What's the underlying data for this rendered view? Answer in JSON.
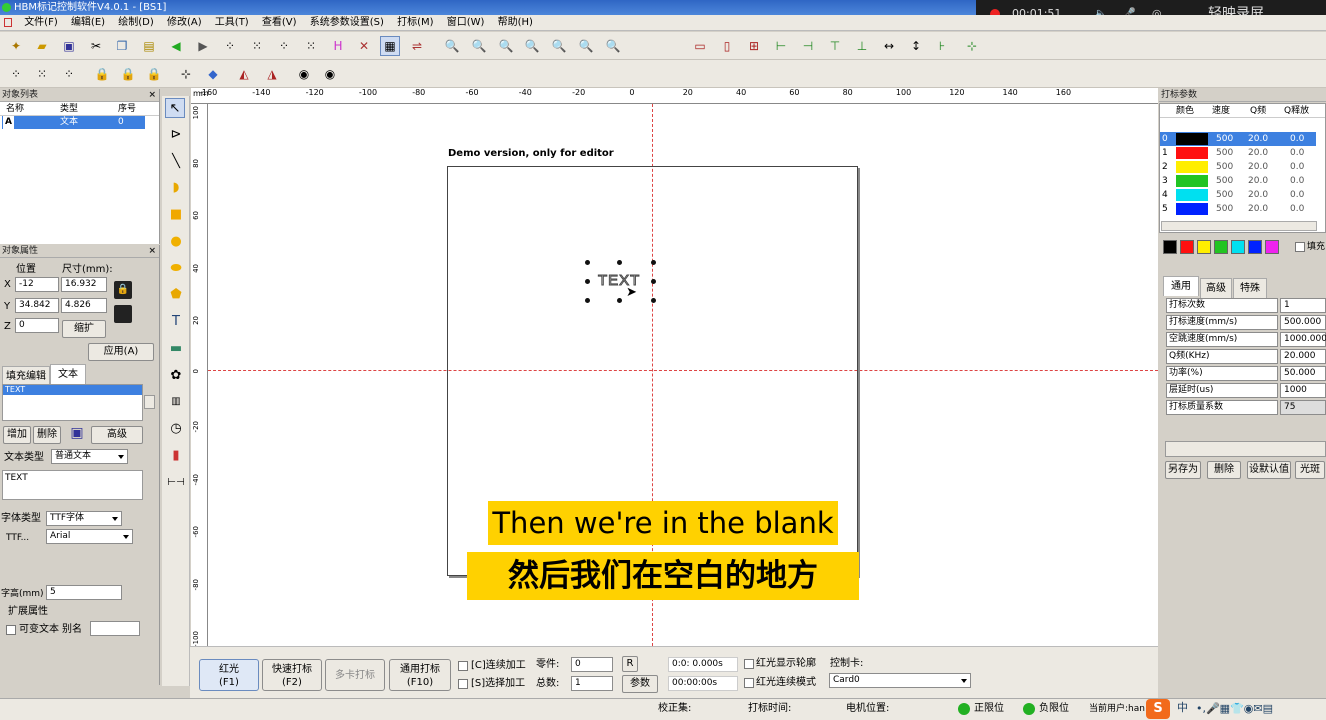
{
  "window": {
    "title": "HBM标记控制软件V4.0.1 - [BS1]"
  },
  "menu": [
    "文件(F)",
    "编辑(E)",
    "绘制(D)",
    "修改(A)",
    "工具(T)",
    "查看(V)",
    "系统参数设置(S)",
    "打标(M)",
    "窗口(W)",
    "帮助(H)"
  ],
  "recorder": {
    "time": "00:01:51",
    "brand": "轻映录屏"
  },
  "object_list": {
    "title": "对象列表",
    "col_name": "名称",
    "col_type": "类型",
    "col_index": "序号",
    "row": {
      "icon": "A",
      "type": "文本",
      "index": "0"
    }
  },
  "object_props": {
    "title": "对象属性",
    "pos_label": "位置",
    "size_label": "尺寸(mm):",
    "x_label": "X",
    "x": "-12",
    "w": "16.932",
    "y_label": "Y",
    "y": "34.842",
    "h": "4.826",
    "z_label": "Z",
    "z": "0",
    "scale_btn": "缩扩",
    "apply_btn": "应用(A)"
  },
  "text_panel": {
    "tab_fill": "填充编辑",
    "tab_text": "文本",
    "list_item": "TEXT",
    "add_btn": "增加",
    "delete_btn": "删除",
    "advanced_btn": "高级",
    "text_type_label": "文本类型",
    "text_type": "普通文本",
    "text_value": "TEXT",
    "font_type_label": "字体类型",
    "font_type": "TTF字体",
    "ttf_label": "TTF...",
    "font_name": "Arial",
    "height_label": "字高(mm)",
    "height": "5",
    "ext_label": "扩展属性",
    "variable_label": "可变文本",
    "alias_label": "别名"
  },
  "canvas": {
    "demo_text": "Demo version, only for editor",
    "object_text": "TEXT",
    "ruler_unit": "mm",
    "ruler_top": [
      "-160",
      "-140",
      "-120",
      "-100",
      "-80",
      "-60",
      "-40",
      "-20",
      "0",
      "20",
      "40",
      "60",
      "80",
      "100",
      "120",
      "140",
      "160"
    ],
    "ruler_left": [
      "100",
      "80",
      "60",
      "40",
      "20",
      "0",
      "-20",
      "-40",
      "-60",
      "-80",
      "-100"
    ]
  },
  "subtitles": {
    "en": "Then we're in the blank",
    "zh": "然后我们在空白的地方"
  },
  "mark_params": {
    "title": "打标参数",
    "col_color": "颜色",
    "col_speed": "速度",
    "col_q": "Q频",
    "col_release": "Q释放",
    "pens": [
      {
        "n": "0",
        "color": "#000000",
        "speed": "500",
        "q": "20.0",
        "r": "0.0"
      },
      {
        "n": "1",
        "color": "#ff1010",
        "speed": "500",
        "q": "20.0",
        "r": "0.0"
      },
      {
        "n": "2",
        "color": "#ffee00",
        "speed": "500",
        "q": "20.0",
        "r": "0.0"
      },
      {
        "n": "3",
        "color": "#22c422",
        "speed": "500",
        "q": "20.0",
        "r": "0.0"
      },
      {
        "n": "4",
        "color": "#00e0f0",
        "speed": "500",
        "q": "20.0",
        "r": "0.0"
      },
      {
        "n": "5",
        "color": "#0022ff",
        "speed": "500",
        "q": "20.0",
        "r": "0.0"
      }
    ],
    "fill_label": "填充",
    "tabs": [
      "通用",
      "高级",
      "特殊"
    ],
    "rows": [
      {
        "k": "打标次数",
        "v": "1"
      },
      {
        "k": "打标速度(mm/s)",
        "v": "500.000"
      },
      {
        "k": "空跳速度(mm/s)",
        "v": "1000.000"
      },
      {
        "k": "Q频(KHz)",
        "v": "20.000"
      },
      {
        "k": "功率(%)",
        "v": "50.000"
      },
      {
        "k": "层延时(us)",
        "v": "1000"
      },
      {
        "k": "打标质量系数",
        "v": "75"
      }
    ],
    "save_as_btn": "另存为",
    "delete_btn": "删除",
    "default_btn": "设默认值",
    "spot_btn": "光斑"
  },
  "bottom": {
    "red_btn": "红光",
    "red_key": "(F1)",
    "fast_btn": "快速打标",
    "fast_key": "(F2)",
    "multi_btn": "多卡打标",
    "general_btn": "通用打标",
    "general_key": "(F10)",
    "continuous_label": "[C]连续加工",
    "select_label": "[S]选择加工",
    "part_label": "零件:",
    "part": "0",
    "r_btn": "R",
    "total_label": "总数:",
    "total": "1",
    "param_btn": "参数",
    "time1": "0:0: 0.000s",
    "time2": "00:00:00s",
    "red_contour": "红光显示轮廓",
    "red_continuous": "红光连续模式",
    "card_label": "控制卡:",
    "card": "Card0"
  },
  "status": {
    "calib": "校正集:",
    "mark_time": "打标时间:",
    "motor": "电机位置:",
    "pos_limit": "正限位",
    "neg_limit": "负限位",
    "user": "当前用户:han",
    "ime": "中"
  }
}
